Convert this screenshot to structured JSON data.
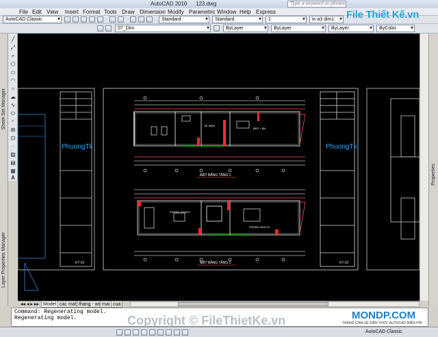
{
  "window": {
    "app_title": "AutoCAD 2010",
    "file_title": "123.dwg",
    "search_placeholder": "Type a keyword or phrase"
  },
  "menu": [
    "File",
    "Edit",
    "View",
    "Insert",
    "Format",
    "Tools",
    "Draw",
    "Dimension",
    "Modify",
    "Parametric",
    "Window",
    "Help",
    "Express"
  ],
  "toolbar": {
    "workspace": "AutoCAD Classic",
    "dimstyle": "Standard",
    "layer": "07_Dim",
    "linetype": "ByLayer",
    "lineweight": "ByLayer",
    "plotstyle": "ByColor",
    "scale": "1",
    "dim_combo": "in a3 dim1",
    "color_combo": "ByLayer"
  },
  "palettes": {
    "sheet_set": "Sheet Set Manager",
    "layer_props": "Layer Properties Manager",
    "properties": "Properties"
  },
  "drawing": {
    "sheet_labels": [
      "PhuongTk",
      "PhuongTk"
    ],
    "plan_titles": [
      "MẶT BẰNG TẦNG 1",
      "MẶT BẰNG TẦNG 2"
    ],
    "room_labels": [
      "PHÒNG KHÁCH",
      "PHÒNG NGỦ 01",
      "VỆ SINH",
      "BẾP + ĂN"
    ],
    "sheet_codes": [
      "KT-03",
      "KT-02"
    ]
  },
  "tabs": [
    "Model",
    "cac mat",
    "thang - wc",
    "mai",
    "cua"
  ],
  "active_tab": "Model",
  "command": {
    "line1": "Command: Regenerating model.",
    "line2": "Regenerating model."
  },
  "status": {
    "workspace": "AutoCAD Classic"
  },
  "watermarks": {
    "brand": "File Thiết Kế.vn",
    "copyright": "Copyright © FileThietKe.vn",
    "mondp": "MONDP.COM",
    "mondp_sub": "TRANG CHIA SẺ KIẾN THỨC AUTOCAD MIỄN PHÍ"
  },
  "colors": {
    "canvas": "#000000",
    "linework": "#ffffff",
    "dim": "#ff3b3b",
    "accent": "#22aaff"
  }
}
